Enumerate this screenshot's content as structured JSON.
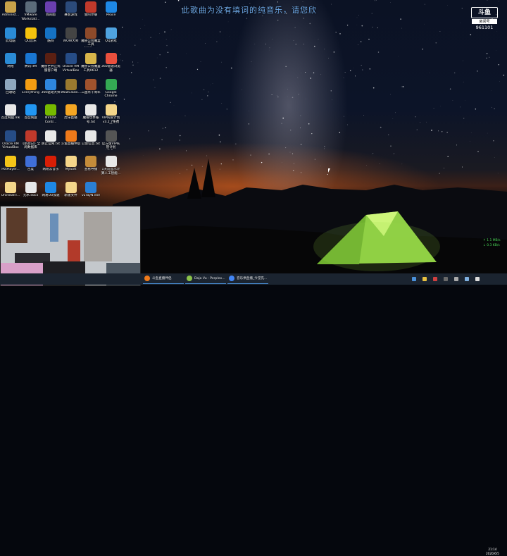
{
  "lyric_text": "此歌曲为没有填词的纯音乐，请您欣",
  "badge": {
    "logo": "斗鱼",
    "sub": "房间号",
    "room": "961101"
  },
  "desktop_icons": [
    {
      "label": "Administ...",
      "color": "#c9a34a"
    },
    {
      "label": "VMware Workstati...",
      "color": "#5b6b7a"
    },
    {
      "label": "我的图",
      "color": "#6a3fb0"
    },
    {
      "label": "赛客游戏",
      "color": "#2b4a7a"
    },
    {
      "label": "金阿尔联",
      "color": "#c0392b"
    },
    {
      "label": "Peace",
      "color": "#1e88e5"
    },
    {
      "label": "此电脑",
      "color": "#2a8bd6"
    },
    {
      "label": "QQ音乐",
      "color": "#f4c20d"
    },
    {
      "label": "酷狗",
      "color": "#1572c4"
    },
    {
      "label": "WOW大师",
      "color": "#444444"
    },
    {
      "label": "魔兽公会魔盒 工具0612.rar",
      "color": "#8e4a2a"
    },
    {
      "label": "QQ游戏",
      "color": "#4fa3e0"
    },
    {
      "label": "网络",
      "color": "#2a8bd6"
    },
    {
      "label": "腾讯TIM",
      "color": "#1976d2"
    },
    {
      "label": "魔兽世界正式 服客户端",
      "color": "#5a1f12"
    },
    {
      "label": "Oracle VM VirtualBox",
      "color": "#264c86"
    },
    {
      "label": "魔兽公会魔盒 工具0612",
      "color": "#d8b54a"
    },
    {
      "label": "360极速浏览器",
      "color": "#e94f3d"
    },
    {
      "label": "回收站",
      "color": "#8fa8c0"
    },
    {
      "label": "Everything",
      "color": "#f39c12"
    },
    {
      "label": "360驱动大师",
      "color": "#2e86de"
    },
    {
      "label": "WowClassi...",
      "color": "#9b7a2f"
    },
    {
      "label": "三国杀十周年",
      "color": "#a0522d"
    },
    {
      "label": "Google Chrome",
      "color": "#34a853"
    },
    {
      "label": "百度网盘.lnk",
      "color": "#e8e8e8"
    },
    {
      "label": "百度网盘",
      "color": "#2196f3"
    },
    {
      "label": "NVIDIA Contr...",
      "color": "#76b900"
    },
    {
      "label": "虎牙直播",
      "color": "#f5a623"
    },
    {
      "label": "魔兽世界账号.txt",
      "color": "#e8e8e8"
    },
    {
      "label": "VIP托管计划 v3.2.7免费版",
      "color": "#f5d68a"
    },
    {
      "label": "Oracle VM VirtualBox",
      "color": "#264c86"
    },
    {
      "label": "《新战记》全 局数据库",
      "color": "#c0392b"
    },
    {
      "label": "防止官网.txt",
      "color": "#e8e8e8"
    },
    {
      "label": "斗鱼直播伴侣",
      "color": "#f07a1a"
    },
    {
      "label": "公会信息.txt",
      "color": "#e8e8e8"
    },
    {
      "label": "官方版VIP托 管计划V3.2...",
      "color": "#555555"
    },
    {
      "label": "PotPlayer...",
      "color": "#f5c518"
    },
    {
      "label": "百度",
      "color": "#3f6fd8"
    },
    {
      "label": "网易云音乐",
      "color": "#d81e06"
    },
    {
      "label": "MySoft",
      "color": "#f5d68a"
    },
    {
      "label": "查看导播",
      "color": "#c58c3a"
    },
    {
      "label": "1天前显示计 算人工智能...",
      "color": "#e8e8e8"
    },
    {
      "label": "UninstallT...",
      "color": "#f5d68a"
    },
    {
      "label": "无水.docx",
      "color": "#e8e8e8"
    },
    {
      "label": "网易UU加速",
      "color": "#1e88e5"
    },
    {
      "label": "新建文件",
      "color": "#f5d68a"
    },
    {
      "label": "v2rayN.exe",
      "color": "#2a7fd4"
    }
  ],
  "taskbar": {
    "tasks": [
      {
        "label": "斗鱼直播伴侣",
        "color": "#f07a1a"
      },
      {
        "label": "Daja Vu - Perplex...",
        "color": "#8bc34a"
      },
      {
        "label": "音乐供直播_今堂先...",
        "color": "#4285f4"
      }
    ],
    "clock_time": "21:14",
    "clock_date": "2020/6/5"
  },
  "net_speed": {
    "up": "↑ 1.1 MB/s",
    "down": "↓ 0.3 KB/s"
  },
  "colors": {
    "lyric": "#6ea9e8",
    "taskbar": "#1b2430",
    "tent": "#9be04a"
  }
}
